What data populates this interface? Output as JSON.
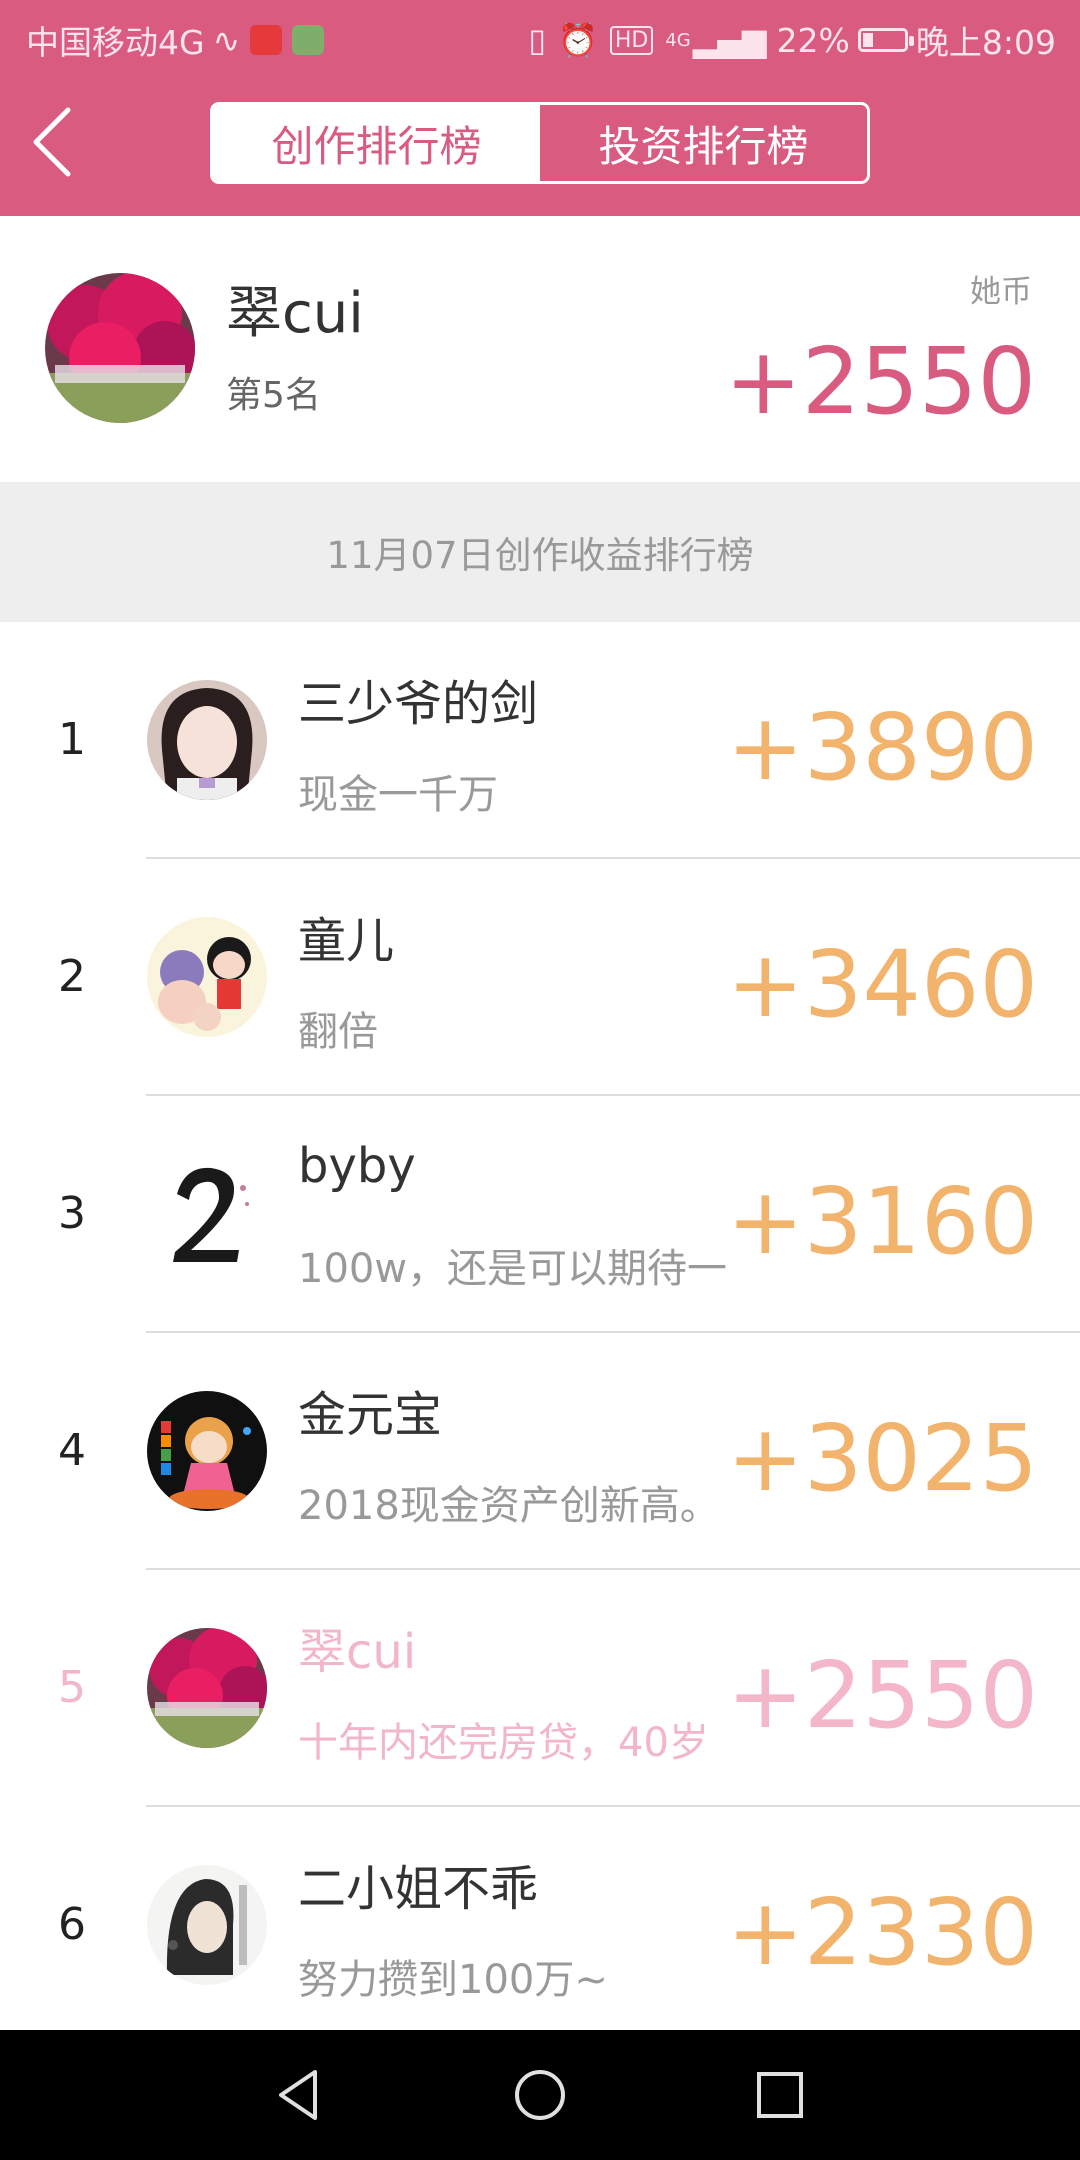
{
  "status_bar": {
    "carrier": "中国移动4G",
    "network": "4G",
    "battery": "22%",
    "time": "晚上8:09"
  },
  "header": {
    "tabs": [
      {
        "label": "创作排行榜",
        "active": true
      },
      {
        "label": "投资排行榜",
        "active": false
      }
    ]
  },
  "my_rank": {
    "name": "翠cui",
    "rank_label": "第5名",
    "unit": "她币",
    "value": "+2550"
  },
  "section_title": "11月07日创作收益排行榜",
  "rankings": [
    {
      "rank": "1",
      "name": "三少爷的剑",
      "desc": "现金一千万",
      "value": "+3890"
    },
    {
      "rank": "2",
      "name": "童儿",
      "desc": "翻倍",
      "value": "+3460"
    },
    {
      "rank": "3",
      "name": "byby",
      "desc": "100w，还是可以期待一",
      "value": "+3160"
    },
    {
      "rank": "4",
      "name": "金元宝",
      "desc": "2018现金资产创新高。",
      "value": "+3025"
    },
    {
      "rank": "5",
      "name": "翠cui",
      "desc": "十年内还完房贷，40岁",
      "value": "+2550"
    },
    {
      "rank": "6",
      "name": "二小姐不乖",
      "desc": "努力攒到100万~",
      "value": "+2330"
    }
  ],
  "colors": {
    "brand": "#d95b80",
    "value_orange": "#f2b46c",
    "highlight_pink": "#f2b6c8"
  }
}
